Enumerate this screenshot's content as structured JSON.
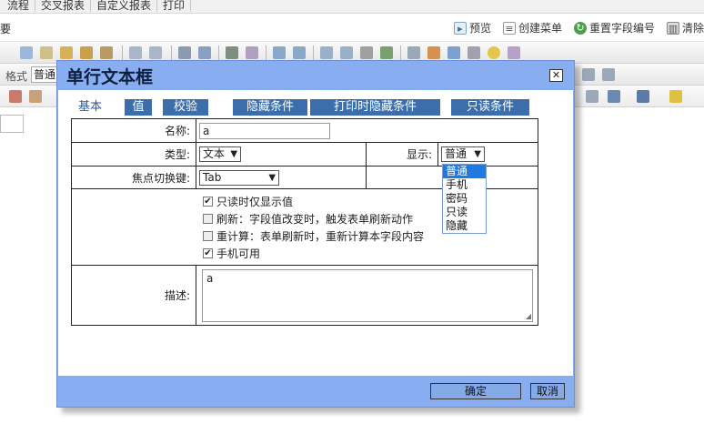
{
  "topnav": [
    "流程",
    "交叉报表",
    "自定义报表",
    "打印"
  ],
  "actionbar": {
    "edge_text": "要",
    "preview": "预览",
    "create_menu": "创建菜单",
    "reset_field_number": "重置字段编号",
    "clear": "清除"
  },
  "toolbar": {
    "format_label": "格式",
    "format_value": "普通"
  },
  "dialog": {
    "title": "单行文本框",
    "close_glyph": "✕",
    "tabs": [
      "基本",
      "值",
      "校验",
      "隐藏条件",
      "打印时隐藏条件",
      "只读条件"
    ],
    "fields": {
      "name_label": "名称:",
      "name_value": "a",
      "type_label": "类型:",
      "type_value": "文本",
      "display_label": "显示:",
      "display_value": "普通",
      "focus_label": "焦点切换键:",
      "focus_value": "Tab",
      "desc_label": "描述:",
      "desc_value": "a"
    },
    "checkboxes": [
      {
        "label": "只读时仅显示值",
        "checked": true
      },
      {
        "label": "刷新：字段值改变时，触发表单刷新动作",
        "checked": false
      },
      {
        "label": "重计算：表单刷新时，重新计算本字段内容",
        "checked": false
      },
      {
        "label": "手机可用",
        "checked": true
      }
    ],
    "display_options": [
      "普通",
      "手机",
      "密码",
      "只读",
      "隐藏"
    ],
    "ok_label": "确定",
    "cancel_label": "取消"
  },
  "colors": {
    "dialog_bg": "#89adf1",
    "tab_bg": "#3d6eac",
    "button_bg": "#86a9e8",
    "dropdown_selected": "#1f7ae0"
  }
}
